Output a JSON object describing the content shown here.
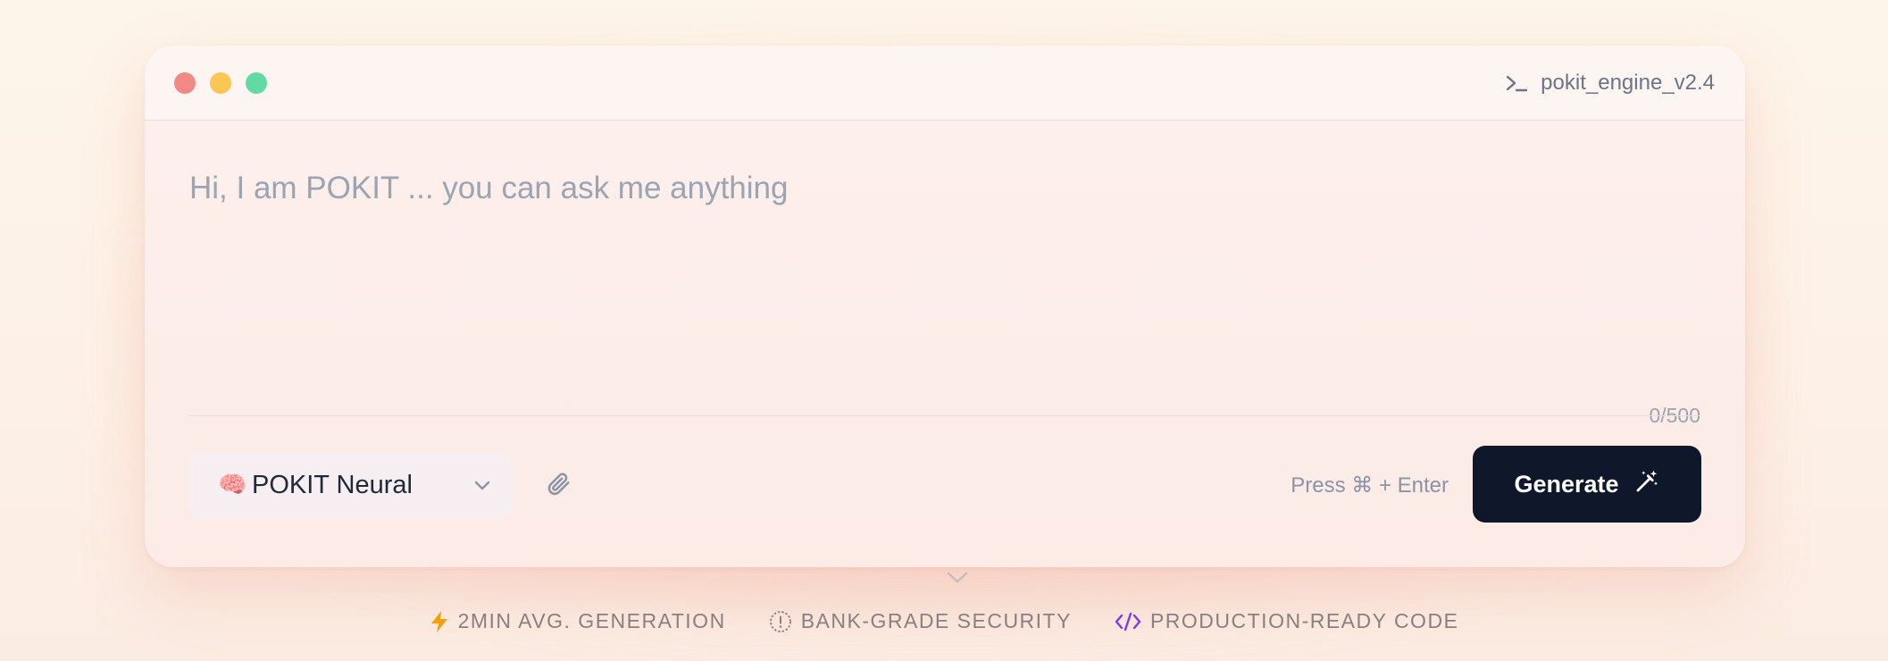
{
  "window": {
    "engine_label": "pokit_engine_v2.4"
  },
  "prompt": {
    "placeholder": "Hi, I am POKIT ... you can ask me anything",
    "value": "",
    "counter": "0/500"
  },
  "toolbar": {
    "model": {
      "emoji": "🧠",
      "label": "POKIT Neural"
    },
    "shortcut_hint": "Press ⌘ + Enter",
    "generate_label": "Generate"
  },
  "features": [
    {
      "icon": "lightning-icon",
      "label": "2MIN AVG. GENERATION"
    },
    {
      "icon": "info-circle-icon",
      "label": "BANK-GRADE SECURITY"
    },
    {
      "icon": "code-icon",
      "label": "PRODUCTION-READY CODE"
    }
  ],
  "colors": {
    "background": "#fdf3ea",
    "window": "#fcede9",
    "accent_dark": "#0f172a",
    "dot_red": "#f18a86",
    "dot_yellow": "#fbc653",
    "dot_green": "#63d9a6",
    "lightning": "#f59e0b",
    "code": "#7c3aed"
  }
}
